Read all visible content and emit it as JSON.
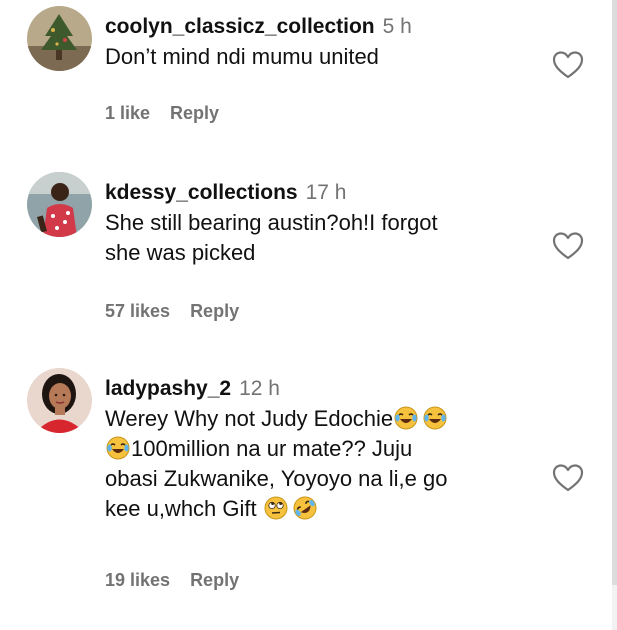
{
  "comments": [
    {
      "username": "coolyn_classicz_collection",
      "time": "5 h",
      "text_lines": [
        "Don’t mind ndi mumu united"
      ],
      "likes": "1 like",
      "reply": "Reply",
      "avatar_icon": "tree-photo-avatar"
    },
    {
      "username": "kdessy_collections",
      "time": "17 h",
      "text_lines": [
        "She still bearing austin?oh!I forgot",
        "she was picked"
      ],
      "likes": "57 likes",
      "reply": "Reply",
      "avatar_icon": "person-photo-avatar"
    },
    {
      "username": "ladypashy_2",
      "time": "12 h",
      "line1": "Werey Why not Judy Edochie",
      "line2": "100million na ur mate?? Juju",
      "line3": "obasi Zukwanike, Yoyoyo na li,e go",
      "line4": "kee u,whch Gift",
      "likes": "19 likes",
      "reply": "Reply",
      "avatar_icon": "woman-photo-avatar"
    }
  ],
  "icons": {
    "like": "heart-outline-icon",
    "emoji_joy": "face-with-tears-of-joy",
    "emoji_eyeroll": "face-with-rolling-eyes",
    "emoji_rofl": "rolling-on-the-floor-laughing"
  },
  "colors": {
    "text": "#111111",
    "secondary": "#737373",
    "background": "#ffffff"
  }
}
